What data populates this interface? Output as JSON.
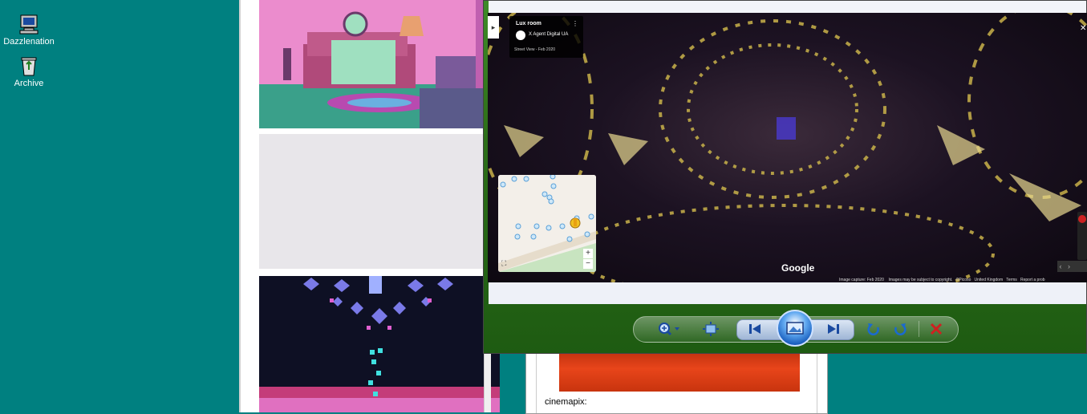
{
  "desktop": {
    "icons": [
      {
        "label": "Dazzlenation",
        "icon": "computer-icon"
      },
      {
        "label": "Archive",
        "icon": "recycle-bin-icon"
      }
    ]
  },
  "street_view": {
    "place_name": "Lux room",
    "owner": "X Agent Digital UA",
    "capture": "Street View - Feb 2020",
    "logo": "Google",
    "footer": [
      "Image capture: Feb 2020",
      "Images may be subject to copyright.",
      "©Picoso",
      "United Kingdom",
      "Terms",
      "Report a prob"
    ],
    "zoom_in": "+",
    "zoom_out": "−"
  },
  "back_window": {
    "caption": "cinemapix:"
  },
  "viewer_toolbar": {
    "buttons": [
      "zoom-icon",
      "actual-size-icon",
      "previous-icon",
      "slideshow-icon",
      "next-icon",
      "rotate-left-icon",
      "rotate-right-icon",
      "delete-icon"
    ]
  },
  "colors": {
    "desktop": "#008080",
    "viewer_glass": "#2c6e18",
    "delete": "#d02020"
  }
}
